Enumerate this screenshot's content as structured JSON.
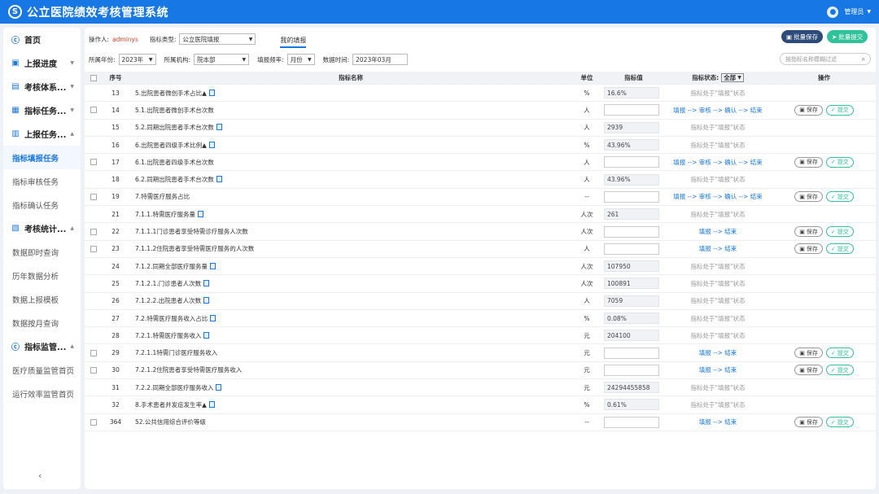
{
  "app": {
    "title": "公立医院绩效考核管理系统",
    "logo_glyph": "S",
    "user": "管理员"
  },
  "sidebar": {
    "items": [
      {
        "type": "nav",
        "label": "首页",
        "icon": "ⓒ",
        "arrow": ""
      },
      {
        "type": "nav",
        "label": "上报进度",
        "icon": "▣",
        "arrow": "▼"
      },
      {
        "type": "nav",
        "label": "考核体系...",
        "icon": "▤",
        "arrow": "▼"
      },
      {
        "type": "nav",
        "label": "指标任务...",
        "icon": "▦",
        "arrow": "▼"
      },
      {
        "type": "nav",
        "label": "上报任务...",
        "icon": "▥",
        "arrow": "▲"
      },
      {
        "type": "sub",
        "label": "指标填报任务",
        "active": true
      },
      {
        "type": "sub",
        "label": "指标审核任务"
      },
      {
        "type": "sub",
        "label": "指标确认任务"
      },
      {
        "type": "nav",
        "label": "考核统计...",
        "icon": "▧",
        "arrow": "▲"
      },
      {
        "type": "sub",
        "label": "数据即时查询"
      },
      {
        "type": "sub",
        "label": "历年数据分析"
      },
      {
        "type": "sub",
        "label": "数据上报模板"
      },
      {
        "type": "sub",
        "label": "数据按月查询"
      },
      {
        "type": "nav",
        "label": "指标监管...",
        "icon": "ⓒ",
        "arrow": "▲"
      },
      {
        "type": "sub",
        "label": "医疗质量监管首页"
      },
      {
        "type": "sub",
        "label": "运行效率监管首页"
      }
    ],
    "collapse": "‹"
  },
  "filters": {
    "operator_label": "操作人:",
    "operator": "adminys",
    "type_label": "指标类型:",
    "type_value": "公立医院填报",
    "tab": "我的填报",
    "year_label": "所属年份:",
    "year": "2023年",
    "org_label": "所属机构:",
    "org": "院本部",
    "freq_label": "填报频率:",
    "freq": "月份",
    "time_label": "数据时间:",
    "time": "2023年03月",
    "search_placeholder": "按指标名称模糊过滤"
  },
  "buttons": {
    "batch_save": "批量保存",
    "batch_submit": "批量提交"
  },
  "table": {
    "headers": {
      "no": "序号",
      "name": "指标名称",
      "unit": "单位",
      "value": "指标值",
      "status": "指标状态:",
      "status_filter": "全部",
      "op": "操作"
    },
    "save_label": "保存",
    "submit_label": "提交",
    "rows": [
      {
        "cb": false,
        "no": "13",
        "name": "5.出院患者微创手术占比▲",
        "doc": true,
        "unit": "%",
        "value": "16.6%",
        "ro": true,
        "status": "指标处于\"填报\"状态",
        "st": "gray",
        "ops": false
      },
      {
        "cb": true,
        "no": "14",
        "name": "5.1.出院患者微创手术台次数",
        "doc": false,
        "unit": "人",
        "value": "",
        "ro": false,
        "status": "填报 --> 审核 --> 确认 --> 结束",
        "st": "flow",
        "ops": true
      },
      {
        "cb": false,
        "no": "15",
        "name": "5.2.同期出院患者手术台次数",
        "doc": true,
        "unit": "人",
        "value": "2939",
        "ro": true,
        "status": "指标处于\"填报\"状态",
        "st": "gray",
        "ops": false
      },
      {
        "cb": false,
        "no": "16",
        "name": "6.出院患者四级手术比例▲",
        "doc": true,
        "unit": "%",
        "value": "43.96%",
        "ro": true,
        "status": "指标处于\"填报\"状态",
        "st": "gray",
        "ops": false
      },
      {
        "cb": true,
        "no": "17",
        "name": "6.1.出院患者四级手术台次数",
        "doc": false,
        "unit": "人",
        "value": "",
        "ro": false,
        "status": "填报 --> 审核 --> 确认 --> 结束",
        "st": "flow",
        "ops": true
      },
      {
        "cb": false,
        "no": "18",
        "name": "6.2.同期出院患者手术台次数",
        "doc": true,
        "unit": "人",
        "value": "43.96%",
        "ro": true,
        "status": "指标处于\"填报\"状态",
        "st": "gray",
        "ops": false
      },
      {
        "cb": true,
        "no": "19",
        "name": "7.特需医疗服务占比",
        "doc": false,
        "unit": "--",
        "value": "",
        "ro": false,
        "status": "填报 --> 审核 --> 确认 --> 结束",
        "st": "flow",
        "ops": true
      },
      {
        "cb": false,
        "no": "21",
        "name": "7.1.1.特需医疗服务量",
        "doc": true,
        "unit": "人次",
        "value": "261",
        "ro": true,
        "status": "指标处于\"填报\"状态",
        "st": "gray",
        "ops": false
      },
      {
        "cb": true,
        "no": "22",
        "name": "7.1.1.1门诊患者享受特需诊疗服务人次数",
        "doc": false,
        "unit": "人次",
        "value": "",
        "ro": false,
        "status": "填报 --> 结束",
        "st": "flow",
        "ops": true
      },
      {
        "cb": true,
        "no": "23",
        "name": "7.1.1.2住院患者享受特需医疗服务的人次数",
        "doc": false,
        "unit": "人",
        "value": "",
        "ro": false,
        "status": "填报 --> 结束",
        "st": "flow",
        "ops": true
      },
      {
        "cb": false,
        "no": "24",
        "name": "7.1.2.同期全部医疗服务量",
        "doc": true,
        "unit": "人次",
        "value": "107950",
        "ro": true,
        "status": "指标处于\"填报\"状态",
        "st": "gray",
        "ops": false
      },
      {
        "cb": false,
        "no": "25",
        "name": "7.1.2.1.门诊患者人次数",
        "doc": true,
        "unit": "人次",
        "value": "100891",
        "ro": true,
        "status": "指标处于\"填报\"状态",
        "st": "gray",
        "ops": false
      },
      {
        "cb": false,
        "no": "26",
        "name": "7.1.2.2.出院患者人次数",
        "doc": true,
        "unit": "人",
        "value": "7059",
        "ro": true,
        "status": "指标处于\"填报\"状态",
        "st": "gray",
        "ops": false
      },
      {
        "cb": false,
        "no": "27",
        "name": "7.2.特需医疗服务收入占比",
        "doc": true,
        "unit": "%",
        "value": "0.08%",
        "ro": true,
        "status": "指标处于\"填报\"状态",
        "st": "gray",
        "ops": false
      },
      {
        "cb": false,
        "no": "28",
        "name": "7.2.1.特需医疗服务收入",
        "doc": true,
        "unit": "元",
        "value": "204100",
        "ro": true,
        "status": "指标处于\"填报\"状态",
        "st": "gray",
        "ops": false
      },
      {
        "cb": true,
        "no": "29",
        "name": "7.2.1.1特需门诊医疗服务收入",
        "doc": false,
        "unit": "元",
        "value": "",
        "ro": false,
        "status": "填报 --> 结束",
        "st": "flow",
        "ops": true
      },
      {
        "cb": true,
        "no": "30",
        "name": "7.2.1.2住院患者享受特需医疗服务收入",
        "doc": false,
        "unit": "元",
        "value": "",
        "ro": false,
        "status": "填报 --> 结束",
        "st": "flow",
        "ops": true
      },
      {
        "cb": false,
        "no": "31",
        "name": "7.2.2.同期全部医疗服务收入",
        "doc": true,
        "unit": "元",
        "value": "24294455858",
        "ro": true,
        "status": "指标处于\"填报\"状态",
        "st": "gray",
        "ops": false
      },
      {
        "cb": false,
        "no": "32",
        "name": "8.手术患者并发症发生率▲",
        "doc": true,
        "unit": "%",
        "value": "0.61%",
        "ro": true,
        "status": "指标处于\"填报\"状态",
        "st": "gray",
        "ops": false
      },
      {
        "cb": true,
        "no": "364",
        "name": "52.公共信用综合评价等级",
        "doc": false,
        "unit": "--",
        "value": "",
        "ro": false,
        "status": "填报 --> 结束",
        "st": "flow",
        "ops": true
      }
    ]
  }
}
